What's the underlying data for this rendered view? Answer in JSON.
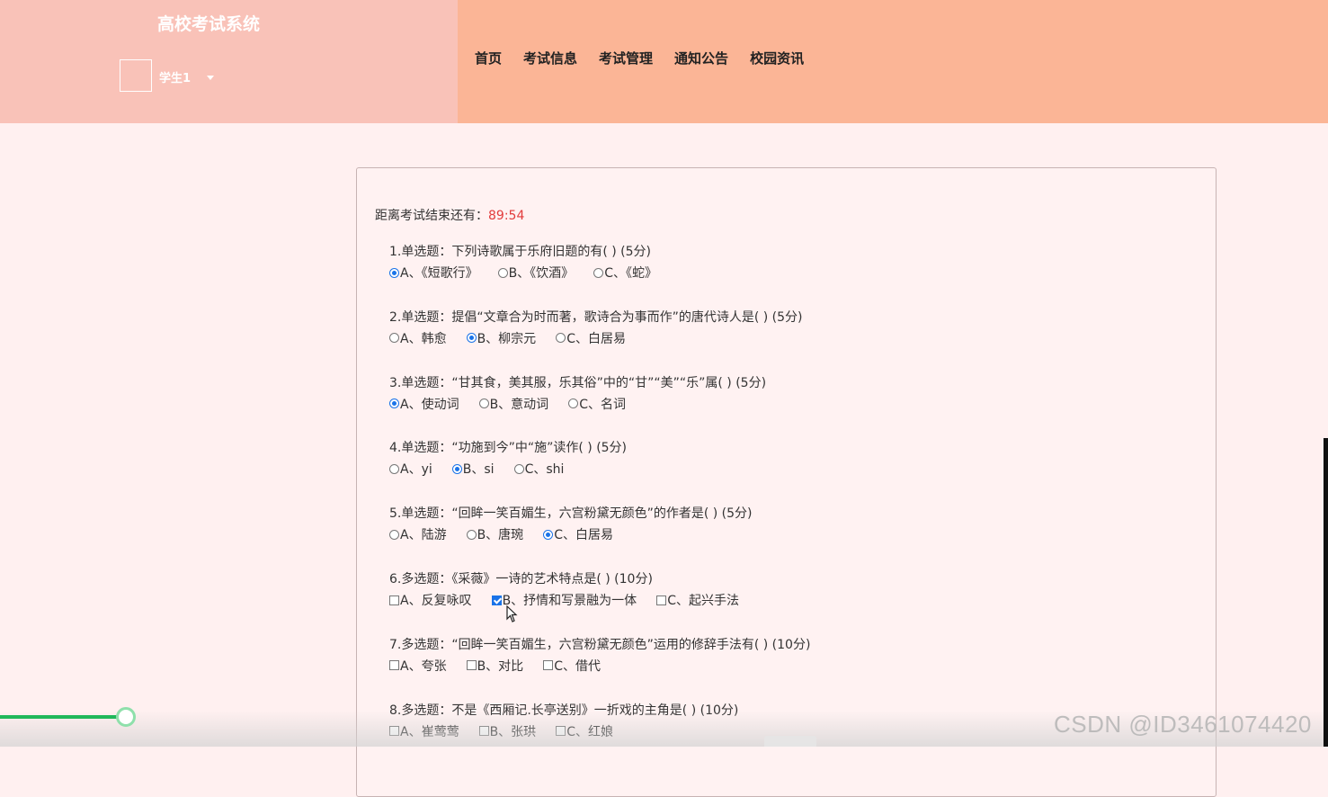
{
  "header": {
    "site_title": "高校考试系统",
    "user_name": "学生1",
    "nav": [
      "首页",
      "考试信息",
      "考试管理",
      "通知公告",
      "校园资讯"
    ]
  },
  "exam": {
    "timer_label": "距离考试结束还有：",
    "timer_value": "89:54",
    "questions": [
      {
        "title": "1.单选题：下列诗歌属于乐府旧题的有( ) (5分)",
        "type": "single",
        "options": [
          {
            "label": "A、《短歌行》",
            "selected": true
          },
          {
            "label": "B、《饮酒》",
            "selected": false
          },
          {
            "label": "C、《蛇》",
            "selected": false
          }
        ]
      },
      {
        "title": "2.单选题：提倡“文章合为时而著，歌诗合为事而作”的唐代诗人是( ) (5分)",
        "type": "single",
        "options": [
          {
            "label": "A、韩愈",
            "selected": false
          },
          {
            "label": "B、柳宗元",
            "selected": true
          },
          {
            "label": "C、白居易",
            "selected": false
          }
        ]
      },
      {
        "title": "3.单选题：“甘其食，美其服，乐其俗”中的“甘”“美”“乐”属( ) (5分)",
        "type": "single",
        "options": [
          {
            "label": "A、使动词",
            "selected": true
          },
          {
            "label": "B、意动词",
            "selected": false
          },
          {
            "label": "C、名词",
            "selected": false
          }
        ]
      },
      {
        "title": "4.单选题：“功施到今”中“施”读作( ) (5分)",
        "type": "single",
        "options": [
          {
            "label": "A、yi",
            "selected": false
          },
          {
            "label": "B、si",
            "selected": true
          },
          {
            "label": "C、shi",
            "selected": false
          }
        ]
      },
      {
        "title": "5.单选题：“回眸一笑百媚生，六宫粉黛无颜色”的作者是( ) (5分)",
        "type": "single",
        "options": [
          {
            "label": "A、陆游",
            "selected": false
          },
          {
            "label": "B、唐琬",
            "selected": false
          },
          {
            "label": "C、白居易",
            "selected": true
          }
        ]
      },
      {
        "title": "6.多选题：《采薇》一诗的艺术特点是( ) (10分)",
        "type": "multi",
        "options": [
          {
            "label": "A、反复咏叹",
            "selected": false
          },
          {
            "label": "B、抒情和写景融为一体",
            "selected": true
          },
          {
            "label": "C、起兴手法",
            "selected": false
          }
        ]
      },
      {
        "title": "7.多选题：“回眸一笑百媚生，六宫粉黛无颜色”运用的修辞手法有( ) (10分)",
        "type": "multi",
        "options": [
          {
            "label": "A、夸张",
            "selected": false
          },
          {
            "label": "B、对比",
            "selected": false
          },
          {
            "label": "C、借代",
            "selected": false
          }
        ]
      },
      {
        "title": "8.多选题：不是《西厢记.长亭送别》一折戏的主角是( ) (10分)",
        "type": "multi",
        "options": [
          {
            "label": "A、崔莺莺",
            "selected": false
          },
          {
            "label": "B、张珙",
            "selected": false
          },
          {
            "label": "C、红娘",
            "selected": false
          }
        ]
      }
    ]
  },
  "watermark": "CSDN @ID3461074420",
  "colors": {
    "brand_panel": "#f9c2b8",
    "nav_panel": "#fbb596",
    "timer": "#e23b3b",
    "progress": "#20b85a"
  }
}
